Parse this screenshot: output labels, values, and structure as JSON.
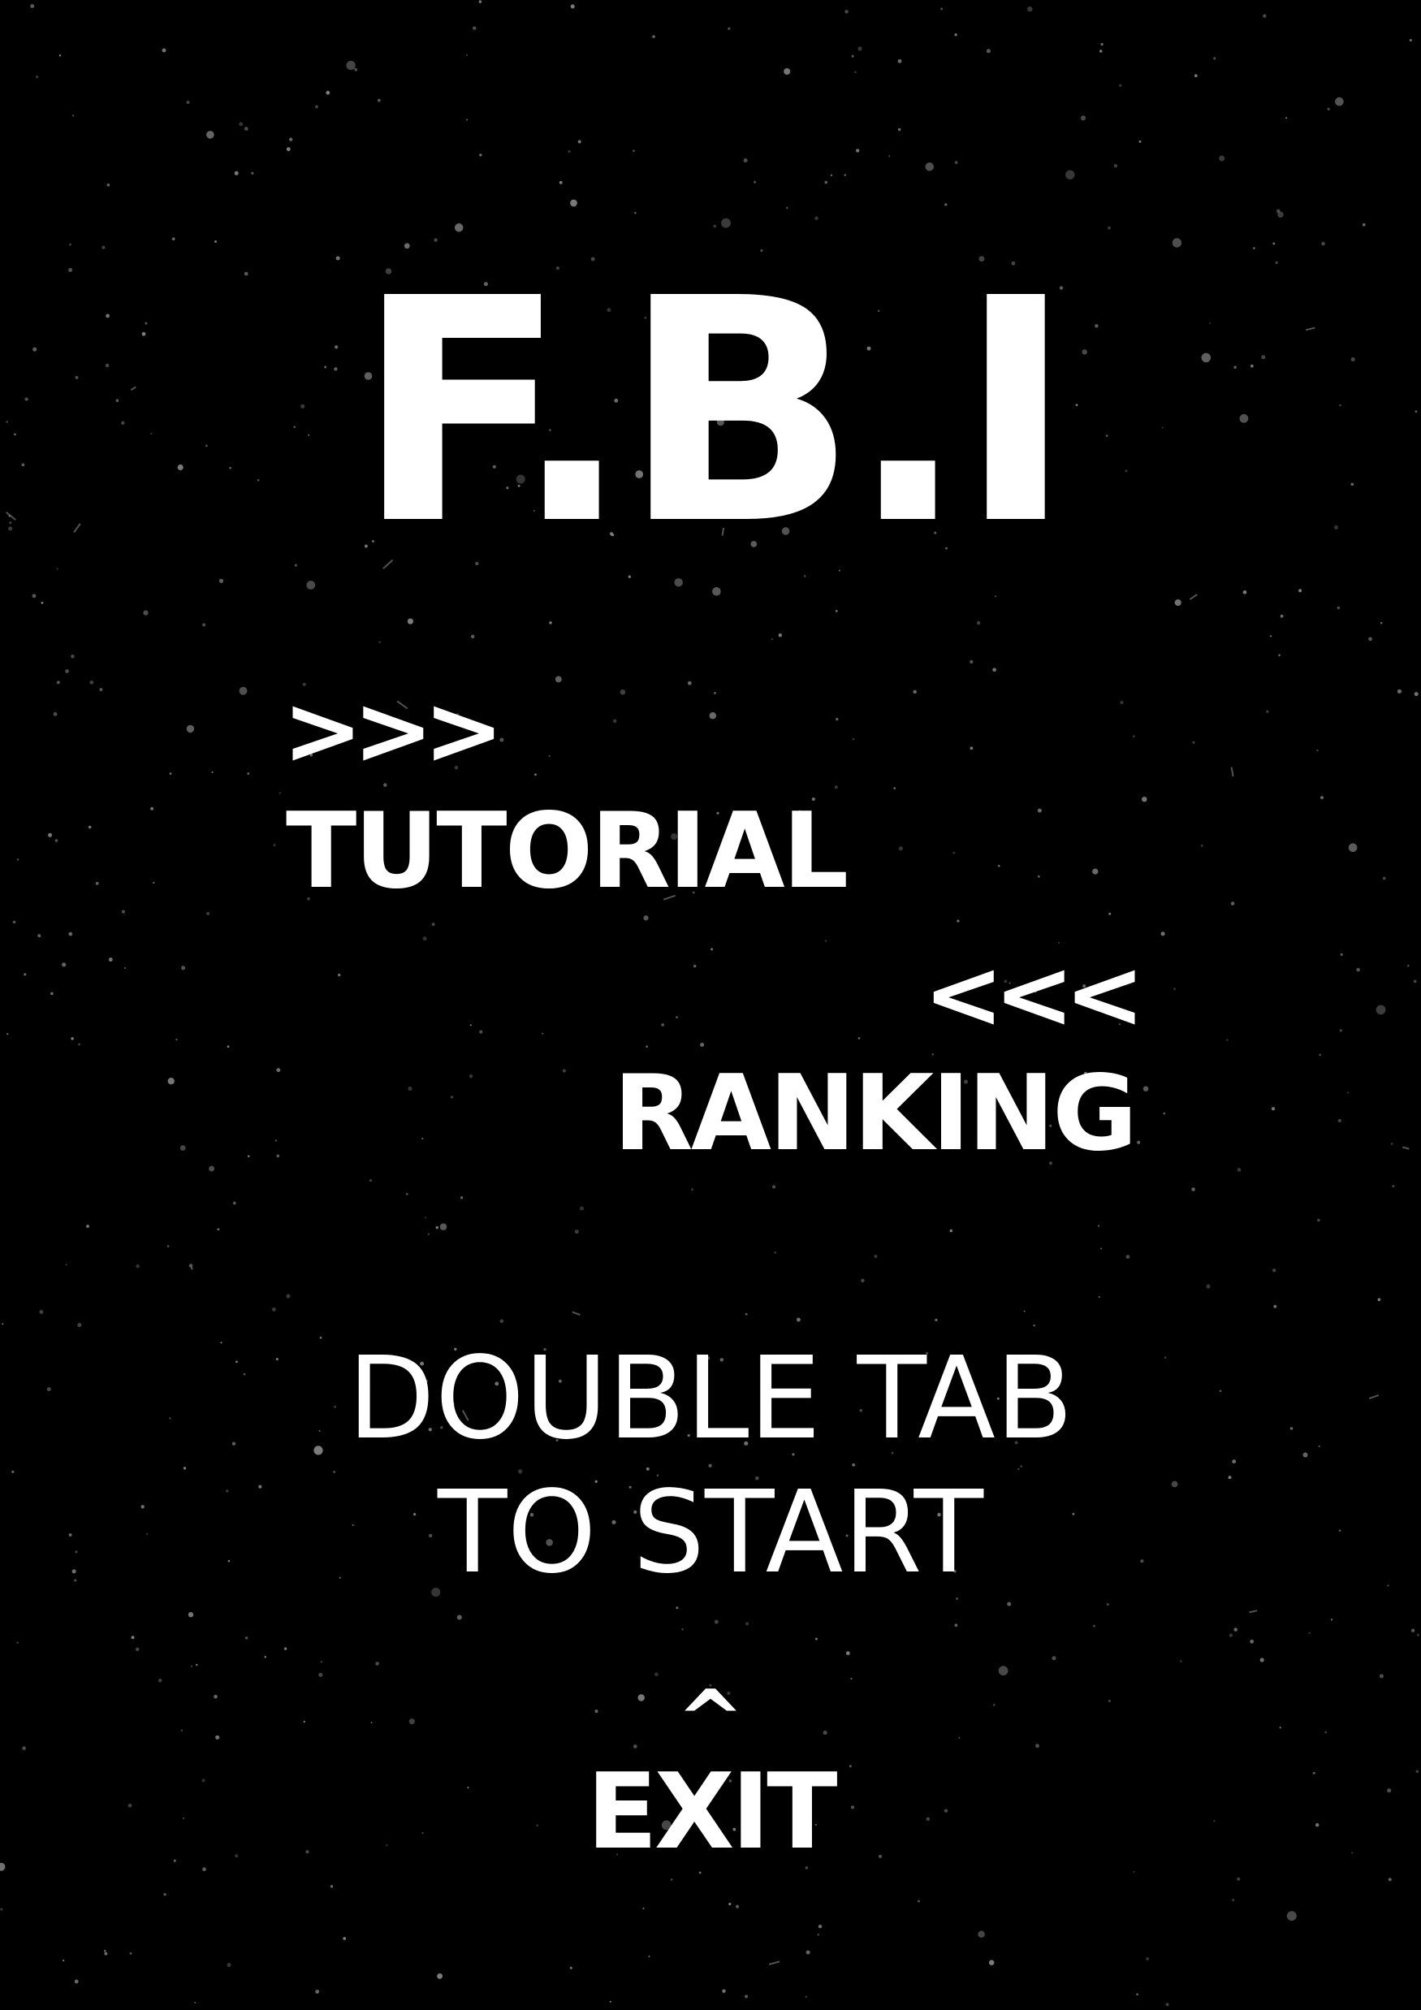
{
  "screen": {
    "background_color": "#000000",
    "text_color": "#ffffff",
    "star_color": "#8a8a8a"
  },
  "title": "F.B.I",
  "menu": {
    "tutorial": {
      "hint": ">>>",
      "label": "TUTORIAL"
    },
    "ranking": {
      "hint": "<<<",
      "label": "RANKING"
    },
    "start": {
      "line1": "DOUBLE TAB",
      "line2": "TO START"
    },
    "exit": {
      "hint": "^",
      "label": "EXIT"
    }
  }
}
